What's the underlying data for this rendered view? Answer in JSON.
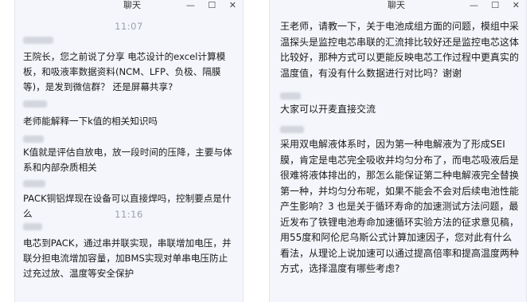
{
  "window": {
    "title": "聊天",
    "minimize": "—",
    "maximize": "☐",
    "close": "✕"
  },
  "left": {
    "timestamps": [
      "11:07",
      "11:16"
    ],
    "messages": [
      "王院长，您之前说了分享 电芯设计的excel计算模板，和吸液率数据资料(NCM、LFP、负极、隔膜等)，是发到微信群？ 还是屏幕共享?",
      "老师能解释一下k值的相关知识吗",
      "K值就是评估自放电，放一段时间的压降，主要与体系和内部杂质相关",
      "PACK铜铝焊现在设备可以直接焊吗，控制要点是什么",
      "电芯到PACK，通过串并联实现，串联增加电压，并联分担电流增加容量，加BMS实现对单串电压防止过充过放、温度等安全保护"
    ]
  },
  "right": {
    "messages": [
      "王老师，请教一下，关于电池成组方面的问题，模组中采温探头是监控电芯串联的汇流排比较好还是监控电芯这体比较好，那种方式可以更能反映电芯工作过程中更真实的温度值，有没有什么数据进行对比吗？谢谢",
      "大家可以开麦直接交流",
      "采用双电解液体系时，因为第一种电解液为了形成SEI膜，肯定是电芯完全吸收并均匀分布了，而电芯吸液后是很难将液体排出的，那怎么能保证第二种电解液完全替换第一种，并均匀分布呢，如果不能会不会对后续电池性能产生影响？3 也是关于循环寿命的加速测试方法问题，最近发布了铁锂电池寿命加速循环实验方法的征求意见稿，用55度和阿伦尼乌斯公式计算加速因子，您对此有什么看法，从理论上说加速可以通过提高倍率和提高温度两种方式，选择温度有哪些考虑?"
    ]
  }
}
